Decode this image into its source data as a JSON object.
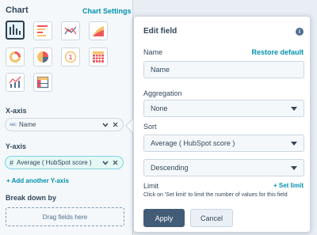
{
  "left_panel": {
    "title": "Chart",
    "settings_link": "Chart Settings",
    "chart_types": [
      {
        "icon": "vertical-bar-chart-icon",
        "selected": true
      },
      {
        "icon": "horizontal-bar-chart-icon",
        "selected": false
      },
      {
        "icon": "line-chart-icon",
        "selected": false
      },
      {
        "icon": "area-chart-icon",
        "selected": false
      },
      {
        "icon": "donut-chart-icon",
        "selected": false
      },
      {
        "icon": "pie-chart-icon",
        "selected": false
      },
      {
        "icon": "summary-number-icon",
        "selected": false
      },
      {
        "icon": "pivot-table-icon",
        "selected": false
      },
      {
        "icon": "combo-chart-icon",
        "selected": false
      },
      {
        "icon": "table-icon",
        "selected": false
      }
    ],
    "x_axis": {
      "label": "X-axis",
      "type_badge": "ABC",
      "value": "Name"
    },
    "y_axis": {
      "label": "Y-axis",
      "type_badge": "#",
      "value": "Average ( HubSpot score )",
      "add_link": "+ Add another Y-axis"
    },
    "breakdown": {
      "label": "Break down by",
      "placeholder": "Drag fields here"
    }
  },
  "edit_field": {
    "title": "Edit field",
    "name_label": "Name",
    "restore_default": "Restore default",
    "name_value": "Name",
    "aggregation_label": "Aggregation",
    "aggregation_value": "None",
    "sort_label": "Sort",
    "sort_by_value": "Average ( HubSpot score )",
    "sort_direction_value": "Descending",
    "limit_label": "Limit",
    "set_limit": "+ Set limit",
    "limit_hint": "Click on 'Set limit' to limit the number of values for this field",
    "apply_label": "Apply",
    "cancel_label": "Cancel"
  },
  "colors": {
    "accent": "#0091ae",
    "text": "#33475b",
    "apply_bg": "#425b76",
    "pill_teal": "#e5f8f6",
    "panel_bg": "#f5f8fa"
  }
}
